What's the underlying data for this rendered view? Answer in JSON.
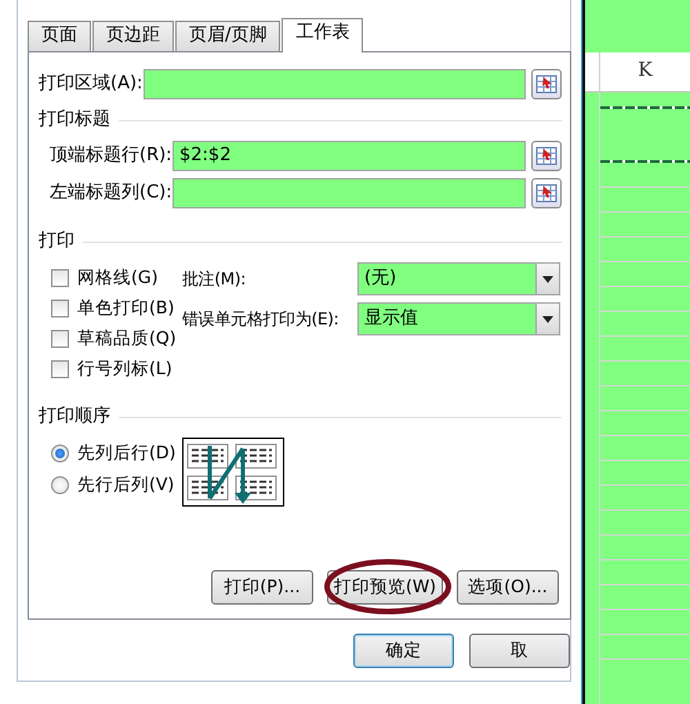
{
  "tabs": [
    {
      "label": "页面",
      "selected": false
    },
    {
      "label": "页边距",
      "selected": false
    },
    {
      "label": "页眉/页脚",
      "selected": false
    },
    {
      "label": "工作表",
      "selected": true
    }
  ],
  "print_area": {
    "label": "打印区域(A):"
  },
  "print_titles": {
    "heading": "打印标题",
    "fields": [
      {
        "label": "顶端标题行(R):",
        "value": "$2:$2"
      },
      {
        "label": "左端标题列(C):"
      }
    ]
  },
  "print": {
    "heading": "打印",
    "checkboxes": [
      {
        "label": "网格线(G)",
        "checked": false
      },
      {
        "label": "单色打印(B)",
        "checked": false
      },
      {
        "label": "草稿品质(Q)",
        "checked": false
      },
      {
        "label": "行号列标(L)",
        "checked": false
      }
    ],
    "selects": [
      {
        "label": "批注(M):",
        "value": "(无)"
      },
      {
        "label": "错误单元格打印为(E):",
        "value": "显示值"
      }
    ]
  },
  "page_order": {
    "heading": "打印顺序",
    "options": [
      {
        "label": "先列后行(D)",
        "selected": true
      },
      {
        "label": "先行后列(V)",
        "selected": false
      }
    ]
  },
  "panel_buttons": [
    {
      "label": "打印(P)...",
      "highlighted": false
    },
    {
      "label": "打印预览(W)",
      "highlighted": true
    },
    {
      "label": "选项(O)...",
      "highlighted": false
    }
  ],
  "footer_buttons": [
    {
      "label": "确定",
      "default": true
    },
    {
      "label": "取",
      "default": false
    }
  ],
  "sheet": {
    "column_header": "K"
  }
}
